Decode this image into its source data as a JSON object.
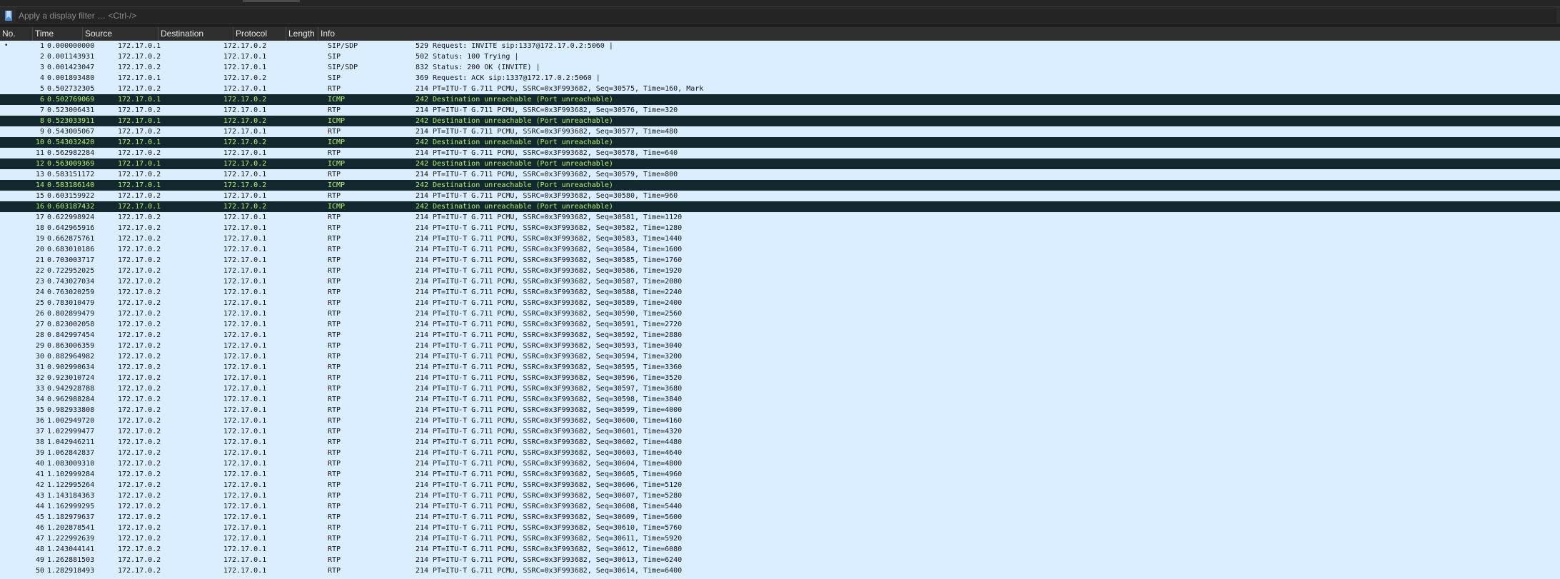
{
  "filter": {
    "placeholder": "Apply a display filter … <Ctrl-/>",
    "value": ""
  },
  "columns": {
    "no": "No.",
    "time": "Time",
    "source": "Source",
    "destination": "Destination",
    "protocol": "Protocol",
    "length": "Length",
    "info": "Info"
  },
  "colors": {
    "default_row_bg": "#daeeff",
    "icmp_row_bg": "#12272e",
    "icmp_row_fg": "#b6f26f"
  },
  "packets": [
    {
      "no": "1",
      "time": "0.000000000",
      "src": "172.17.0.1",
      "dst": "172.17.0.2",
      "proto": "SIP/SDP",
      "len": "529",
      "info": "Request: INVITE sip:1337@172.17.0.2:5060 |",
      "marker": "•"
    },
    {
      "no": "2",
      "time": "0.001143931",
      "src": "172.17.0.2",
      "dst": "172.17.0.1",
      "proto": "SIP",
      "len": "502",
      "info": "Status: 100 Trying |"
    },
    {
      "no": "3",
      "time": "0.001423047",
      "src": "172.17.0.2",
      "dst": "172.17.0.1",
      "proto": "SIP/SDP",
      "len": "832",
      "info": "Status: 200 OK (INVITE) |"
    },
    {
      "no": "4",
      "time": "0.001893480",
      "src": "172.17.0.1",
      "dst": "172.17.0.2",
      "proto": "SIP",
      "len": "369",
      "info": "Request: ACK sip:1337@172.17.0.2:5060 |"
    },
    {
      "no": "5",
      "time": "0.502732305",
      "src": "172.17.0.2",
      "dst": "172.17.0.1",
      "proto": "RTP",
      "len": "214",
      "info": "PT=ITU-T G.711 PCMU, SSRC=0x3F993682, Seq=30575, Time=160, Mark"
    },
    {
      "no": "6",
      "time": "0.502769069",
      "src": "172.17.0.1",
      "dst": "172.17.0.2",
      "proto": "ICMP",
      "len": "242",
      "info": "Destination unreachable (Port unreachable)"
    },
    {
      "no": "7",
      "time": "0.523006431",
      "src": "172.17.0.2",
      "dst": "172.17.0.1",
      "proto": "RTP",
      "len": "214",
      "info": "PT=ITU-T G.711 PCMU, SSRC=0x3F993682, Seq=30576, Time=320"
    },
    {
      "no": "8",
      "time": "0.523033911",
      "src": "172.17.0.1",
      "dst": "172.17.0.2",
      "proto": "ICMP",
      "len": "242",
      "info": "Destination unreachable (Port unreachable)"
    },
    {
      "no": "9",
      "time": "0.543005067",
      "src": "172.17.0.2",
      "dst": "172.17.0.1",
      "proto": "RTP",
      "len": "214",
      "info": "PT=ITU-T G.711 PCMU, SSRC=0x3F993682, Seq=30577, Time=480"
    },
    {
      "no": "10",
      "time": "0.543032420",
      "src": "172.17.0.1",
      "dst": "172.17.0.2",
      "proto": "ICMP",
      "len": "242",
      "info": "Destination unreachable (Port unreachable)"
    },
    {
      "no": "11",
      "time": "0.562982284",
      "src": "172.17.0.2",
      "dst": "172.17.0.1",
      "proto": "RTP",
      "len": "214",
      "info": "PT=ITU-T G.711 PCMU, SSRC=0x3F993682, Seq=30578, Time=640"
    },
    {
      "no": "12",
      "time": "0.563009369",
      "src": "172.17.0.1",
      "dst": "172.17.0.2",
      "proto": "ICMP",
      "len": "242",
      "info": "Destination unreachable (Port unreachable)"
    },
    {
      "no": "13",
      "time": "0.583151172",
      "src": "172.17.0.2",
      "dst": "172.17.0.1",
      "proto": "RTP",
      "len": "214",
      "info": "PT=ITU-T G.711 PCMU, SSRC=0x3F993682, Seq=30579, Time=800"
    },
    {
      "no": "14",
      "time": "0.583186140",
      "src": "172.17.0.1",
      "dst": "172.17.0.2",
      "proto": "ICMP",
      "len": "242",
      "info": "Destination unreachable (Port unreachable)"
    },
    {
      "no": "15",
      "time": "0.603159922",
      "src": "172.17.0.2",
      "dst": "172.17.0.1",
      "proto": "RTP",
      "len": "214",
      "info": "PT=ITU-T G.711 PCMU, SSRC=0x3F993682, Seq=30580, Time=960"
    },
    {
      "no": "16",
      "time": "0.603187432",
      "src": "172.17.0.1",
      "dst": "172.17.0.2",
      "proto": "ICMP",
      "len": "242",
      "info": "Destination unreachable (Port unreachable)"
    },
    {
      "no": "17",
      "time": "0.622998924",
      "src": "172.17.0.2",
      "dst": "172.17.0.1",
      "proto": "RTP",
      "len": "214",
      "info": "PT=ITU-T G.711 PCMU, SSRC=0x3F993682, Seq=30581, Time=1120"
    },
    {
      "no": "18",
      "time": "0.642965916",
      "src": "172.17.0.2",
      "dst": "172.17.0.1",
      "proto": "RTP",
      "len": "214",
      "info": "PT=ITU-T G.711 PCMU, SSRC=0x3F993682, Seq=30582, Time=1280"
    },
    {
      "no": "19",
      "time": "0.662875761",
      "src": "172.17.0.2",
      "dst": "172.17.0.1",
      "proto": "RTP",
      "len": "214",
      "info": "PT=ITU-T G.711 PCMU, SSRC=0x3F993682, Seq=30583, Time=1440"
    },
    {
      "no": "20",
      "time": "0.683010186",
      "src": "172.17.0.2",
      "dst": "172.17.0.1",
      "proto": "RTP",
      "len": "214",
      "info": "PT=ITU-T G.711 PCMU, SSRC=0x3F993682, Seq=30584, Time=1600"
    },
    {
      "no": "21",
      "time": "0.703003717",
      "src": "172.17.0.2",
      "dst": "172.17.0.1",
      "proto": "RTP",
      "len": "214",
      "info": "PT=ITU-T G.711 PCMU, SSRC=0x3F993682, Seq=30585, Time=1760"
    },
    {
      "no": "22",
      "time": "0.722952025",
      "src": "172.17.0.2",
      "dst": "172.17.0.1",
      "proto": "RTP",
      "len": "214",
      "info": "PT=ITU-T G.711 PCMU, SSRC=0x3F993682, Seq=30586, Time=1920"
    },
    {
      "no": "23",
      "time": "0.743027034",
      "src": "172.17.0.2",
      "dst": "172.17.0.1",
      "proto": "RTP",
      "len": "214",
      "info": "PT=ITU-T G.711 PCMU, SSRC=0x3F993682, Seq=30587, Time=2080"
    },
    {
      "no": "24",
      "time": "0.763020259",
      "src": "172.17.0.2",
      "dst": "172.17.0.1",
      "proto": "RTP",
      "len": "214",
      "info": "PT=ITU-T G.711 PCMU, SSRC=0x3F993682, Seq=30588, Time=2240"
    },
    {
      "no": "25",
      "time": "0.783010479",
      "src": "172.17.0.2",
      "dst": "172.17.0.1",
      "proto": "RTP",
      "len": "214",
      "info": "PT=ITU-T G.711 PCMU, SSRC=0x3F993682, Seq=30589, Time=2400"
    },
    {
      "no": "26",
      "time": "0.802899479",
      "src": "172.17.0.2",
      "dst": "172.17.0.1",
      "proto": "RTP",
      "len": "214",
      "info": "PT=ITU-T G.711 PCMU, SSRC=0x3F993682, Seq=30590, Time=2560"
    },
    {
      "no": "27",
      "time": "0.823002058",
      "src": "172.17.0.2",
      "dst": "172.17.0.1",
      "proto": "RTP",
      "len": "214",
      "info": "PT=ITU-T G.711 PCMU, SSRC=0x3F993682, Seq=30591, Time=2720"
    },
    {
      "no": "28",
      "time": "0.842997454",
      "src": "172.17.0.2",
      "dst": "172.17.0.1",
      "proto": "RTP",
      "len": "214",
      "info": "PT=ITU-T G.711 PCMU, SSRC=0x3F993682, Seq=30592, Time=2880"
    },
    {
      "no": "29",
      "time": "0.863006359",
      "src": "172.17.0.2",
      "dst": "172.17.0.1",
      "proto": "RTP",
      "len": "214",
      "info": "PT=ITU-T G.711 PCMU, SSRC=0x3F993682, Seq=30593, Time=3040"
    },
    {
      "no": "30",
      "time": "0.882964982",
      "src": "172.17.0.2",
      "dst": "172.17.0.1",
      "proto": "RTP",
      "len": "214",
      "info": "PT=ITU-T G.711 PCMU, SSRC=0x3F993682, Seq=30594, Time=3200"
    },
    {
      "no": "31",
      "time": "0.902990634",
      "src": "172.17.0.2",
      "dst": "172.17.0.1",
      "proto": "RTP",
      "len": "214",
      "info": "PT=ITU-T G.711 PCMU, SSRC=0x3F993682, Seq=30595, Time=3360"
    },
    {
      "no": "32",
      "time": "0.923010724",
      "src": "172.17.0.2",
      "dst": "172.17.0.1",
      "proto": "RTP",
      "len": "214",
      "info": "PT=ITU-T G.711 PCMU, SSRC=0x3F993682, Seq=30596, Time=3520"
    },
    {
      "no": "33",
      "time": "0.942928788",
      "src": "172.17.0.2",
      "dst": "172.17.0.1",
      "proto": "RTP",
      "len": "214",
      "info": "PT=ITU-T G.711 PCMU, SSRC=0x3F993682, Seq=30597, Time=3680"
    },
    {
      "no": "34",
      "time": "0.962988284",
      "src": "172.17.0.2",
      "dst": "172.17.0.1",
      "proto": "RTP",
      "len": "214",
      "info": "PT=ITU-T G.711 PCMU, SSRC=0x3F993682, Seq=30598, Time=3840"
    },
    {
      "no": "35",
      "time": "0.982933808",
      "src": "172.17.0.2",
      "dst": "172.17.0.1",
      "proto": "RTP",
      "len": "214",
      "info": "PT=ITU-T G.711 PCMU, SSRC=0x3F993682, Seq=30599, Time=4000"
    },
    {
      "no": "36",
      "time": "1.002949720",
      "src": "172.17.0.2",
      "dst": "172.17.0.1",
      "proto": "RTP",
      "len": "214",
      "info": "PT=ITU-T G.711 PCMU, SSRC=0x3F993682, Seq=30600, Time=4160"
    },
    {
      "no": "37",
      "time": "1.022999477",
      "src": "172.17.0.2",
      "dst": "172.17.0.1",
      "proto": "RTP",
      "len": "214",
      "info": "PT=ITU-T G.711 PCMU, SSRC=0x3F993682, Seq=30601, Time=4320"
    },
    {
      "no": "38",
      "time": "1.042946211",
      "src": "172.17.0.2",
      "dst": "172.17.0.1",
      "proto": "RTP",
      "len": "214",
      "info": "PT=ITU-T G.711 PCMU, SSRC=0x3F993682, Seq=30602, Time=4480"
    },
    {
      "no": "39",
      "time": "1.062842837",
      "src": "172.17.0.2",
      "dst": "172.17.0.1",
      "proto": "RTP",
      "len": "214",
      "info": "PT=ITU-T G.711 PCMU, SSRC=0x3F993682, Seq=30603, Time=4640"
    },
    {
      "no": "40",
      "time": "1.083009310",
      "src": "172.17.0.2",
      "dst": "172.17.0.1",
      "proto": "RTP",
      "len": "214",
      "info": "PT=ITU-T G.711 PCMU, SSRC=0x3F993682, Seq=30604, Time=4800"
    },
    {
      "no": "41",
      "time": "1.102999284",
      "src": "172.17.0.2",
      "dst": "172.17.0.1",
      "proto": "RTP",
      "len": "214",
      "info": "PT=ITU-T G.711 PCMU, SSRC=0x3F993682, Seq=30605, Time=4960"
    },
    {
      "no": "42",
      "time": "1.122995264",
      "src": "172.17.0.2",
      "dst": "172.17.0.1",
      "proto": "RTP",
      "len": "214",
      "info": "PT=ITU-T G.711 PCMU, SSRC=0x3F993682, Seq=30606, Time=5120"
    },
    {
      "no": "43",
      "time": "1.143184363",
      "src": "172.17.0.2",
      "dst": "172.17.0.1",
      "proto": "RTP",
      "len": "214",
      "info": "PT=ITU-T G.711 PCMU, SSRC=0x3F993682, Seq=30607, Time=5280"
    },
    {
      "no": "44",
      "time": "1.162999295",
      "src": "172.17.0.2",
      "dst": "172.17.0.1",
      "proto": "RTP",
      "len": "214",
      "info": "PT=ITU-T G.711 PCMU, SSRC=0x3F993682, Seq=30608, Time=5440"
    },
    {
      "no": "45",
      "time": "1.182979637",
      "src": "172.17.0.2",
      "dst": "172.17.0.1",
      "proto": "RTP",
      "len": "214",
      "info": "PT=ITU-T G.711 PCMU, SSRC=0x3F993682, Seq=30609, Time=5600"
    },
    {
      "no": "46",
      "time": "1.202878541",
      "src": "172.17.0.2",
      "dst": "172.17.0.1",
      "proto": "RTP",
      "len": "214",
      "info": "PT=ITU-T G.711 PCMU, SSRC=0x3F993682, Seq=30610, Time=5760"
    },
    {
      "no": "47",
      "time": "1.222992639",
      "src": "172.17.0.2",
      "dst": "172.17.0.1",
      "proto": "RTP",
      "len": "214",
      "info": "PT=ITU-T G.711 PCMU, SSRC=0x3F993682, Seq=30611, Time=5920"
    },
    {
      "no": "48",
      "time": "1.243044141",
      "src": "172.17.0.2",
      "dst": "172.17.0.1",
      "proto": "RTP",
      "len": "214",
      "info": "PT=ITU-T G.711 PCMU, SSRC=0x3F993682, Seq=30612, Time=6080"
    },
    {
      "no": "49",
      "time": "1.262881503",
      "src": "172.17.0.2",
      "dst": "172.17.0.1",
      "proto": "RTP",
      "len": "214",
      "info": "PT=ITU-T G.711 PCMU, SSRC=0x3F993682, Seq=30613, Time=6240"
    },
    {
      "no": "50",
      "time": "1.282918493",
      "src": "172.17.0.2",
      "dst": "172.17.0.1",
      "proto": "RTP",
      "len": "214",
      "info": "PT=ITU-T G.711 PCMU, SSRC=0x3F993682, Seq=30614, Time=6400"
    }
  ]
}
